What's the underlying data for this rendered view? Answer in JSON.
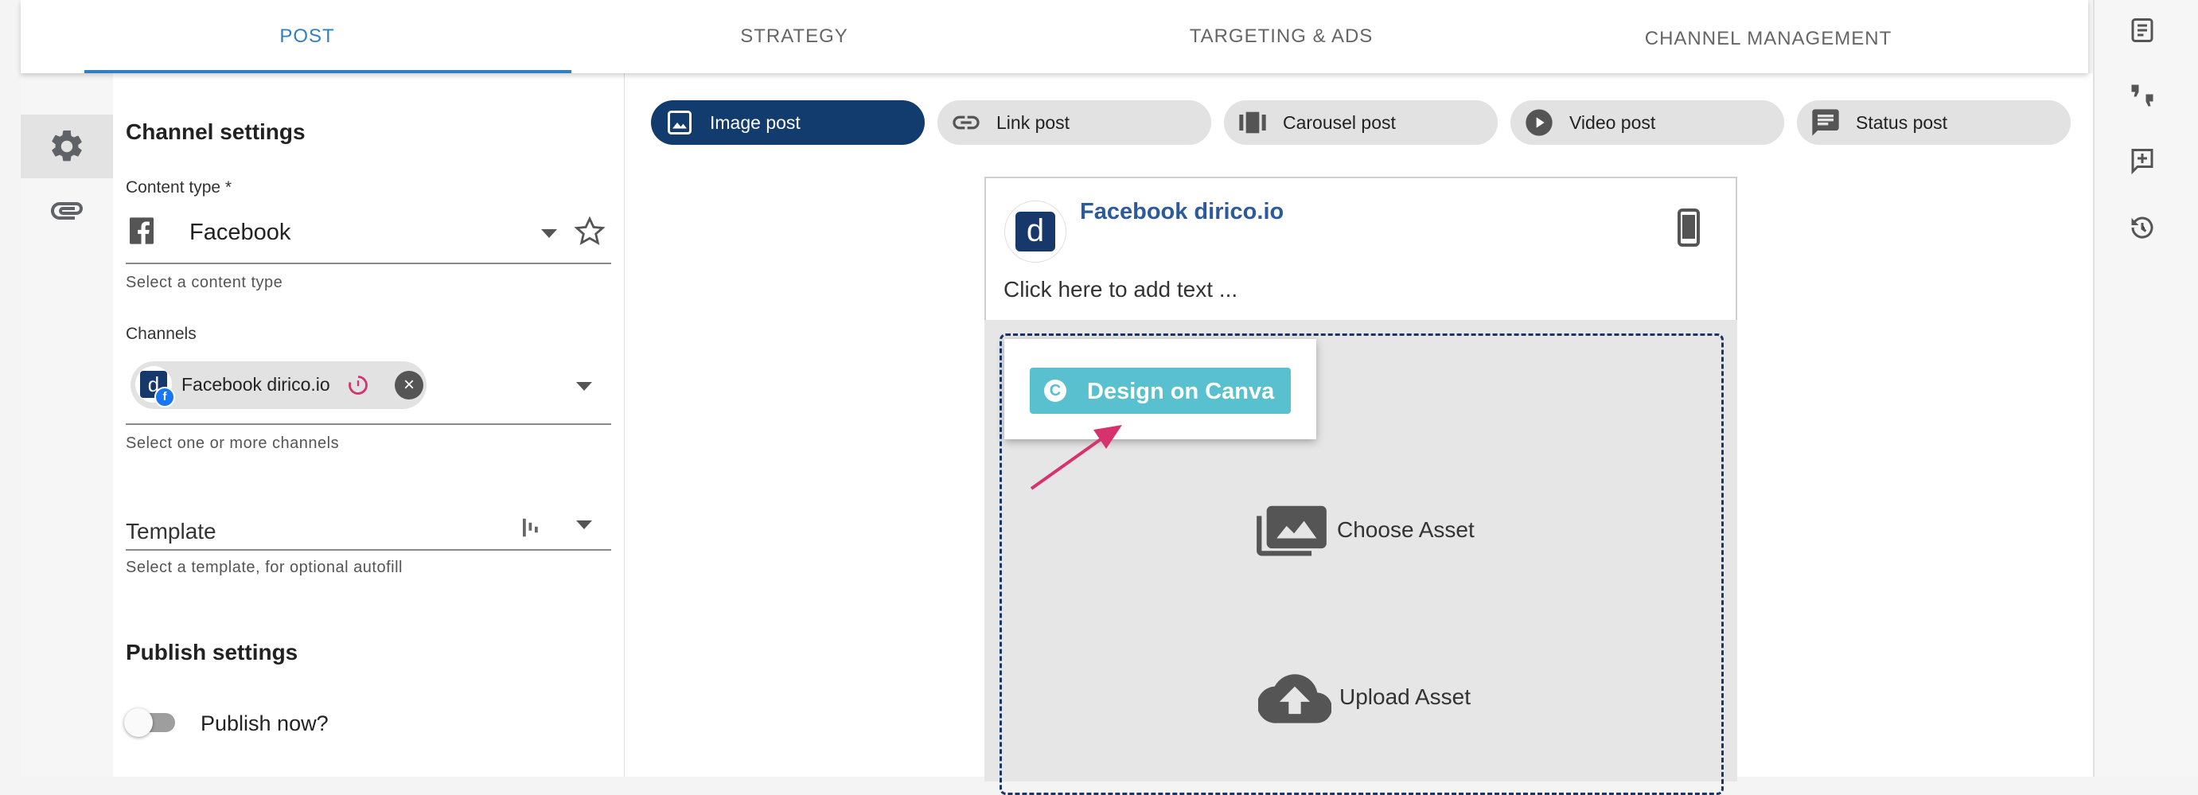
{
  "tabs": [
    {
      "label": "POST",
      "active": true
    },
    {
      "label": "STRATEGY",
      "active": false
    },
    {
      "label": "TARGETING & ADS",
      "active": false
    },
    {
      "label": "CHANNEL MANAGEMENT",
      "active": false
    }
  ],
  "left_rail": {
    "icons": [
      "gear-icon",
      "attachment-icon"
    ],
    "active": "gear-icon"
  },
  "settings": {
    "channel_heading": "Channel settings",
    "content_type": {
      "label": "Content type *",
      "value": "Facebook",
      "help": "Select a content type"
    },
    "channels": {
      "label": "Channels",
      "chip": "Facebook dirico.io",
      "help": "Select one or more channels"
    },
    "template": {
      "label": "Template",
      "help": "Select a template, for optional autofill"
    },
    "publish_heading": "Publish settings",
    "publish_now": {
      "label": "Publish now?",
      "on": false
    }
  },
  "post_types": [
    {
      "label": "Image post",
      "icon": "image-icon",
      "active": true
    },
    {
      "label": "Link post",
      "icon": "link-icon",
      "active": false
    },
    {
      "label": "Carousel post",
      "icon": "carousel-icon",
      "active": false
    },
    {
      "label": "Video post",
      "icon": "play-icon",
      "active": false
    },
    {
      "label": "Status post",
      "icon": "message-icon",
      "active": false
    }
  ],
  "preview": {
    "page_name": "Facebook dirico.io",
    "text_placeholder": "Click here to add text ...",
    "canva_button": "Design on Canva",
    "choose_asset": "Choose Asset",
    "upload_asset": "Upload Asset"
  },
  "right_rail": {
    "icons": [
      "notes-icon",
      "feedback-icon",
      "comment-add-icon",
      "history-icon"
    ]
  },
  "colors": {
    "primary": "#2f7fc1",
    "navy": "#133c6e",
    "canva": "#58c0cf",
    "arrow": "#d6336c"
  }
}
